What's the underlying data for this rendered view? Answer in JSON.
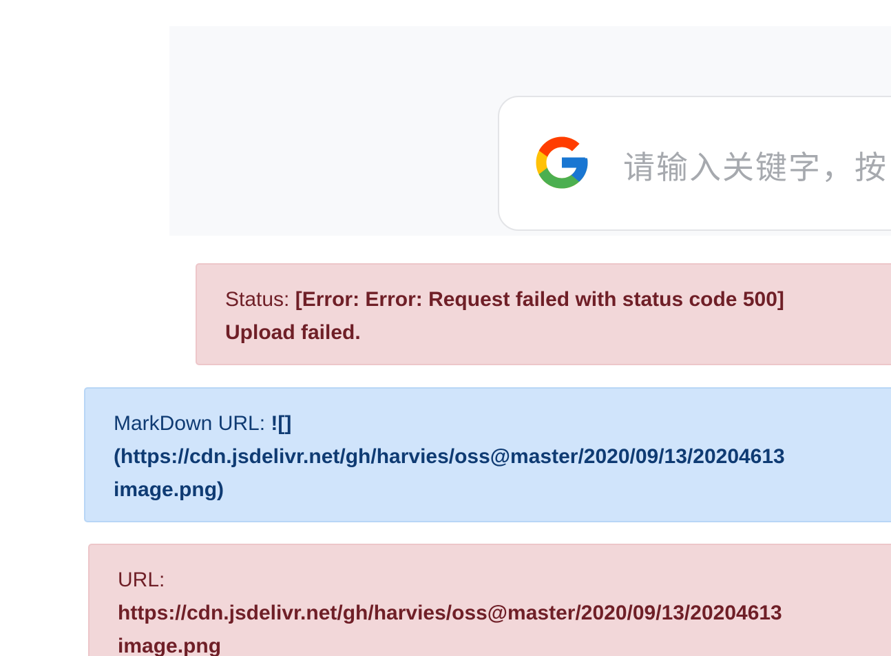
{
  "search": {
    "placeholder": "请输入关键字，按"
  },
  "status_alert": {
    "label": "Status: ",
    "message_line1": "[Error: Error: Request failed with status code 500]",
    "message_line2": "Upload failed."
  },
  "markdown_alert": {
    "label": "MarkDown URL: ",
    "value_line1": "![]",
    "value_line2": "(https://cdn.jsdelivr.net/gh/harvies/oss@master/2020/09/13/20204613",
    "value_line3": "image.png)"
  },
  "url_alert": {
    "label": "URL:",
    "value_line1": "https://cdn.jsdelivr.net/gh/harvies/oss@master/2020/09/13/20204613",
    "value_line2": "image.png"
  },
  "colors": {
    "danger_bg": "#f2d7d9",
    "danger_text": "#6f1f27",
    "info_bg": "#d0e4fb",
    "info_text": "#0f3b73"
  },
  "icons": {
    "search_brand": "google-icon"
  }
}
